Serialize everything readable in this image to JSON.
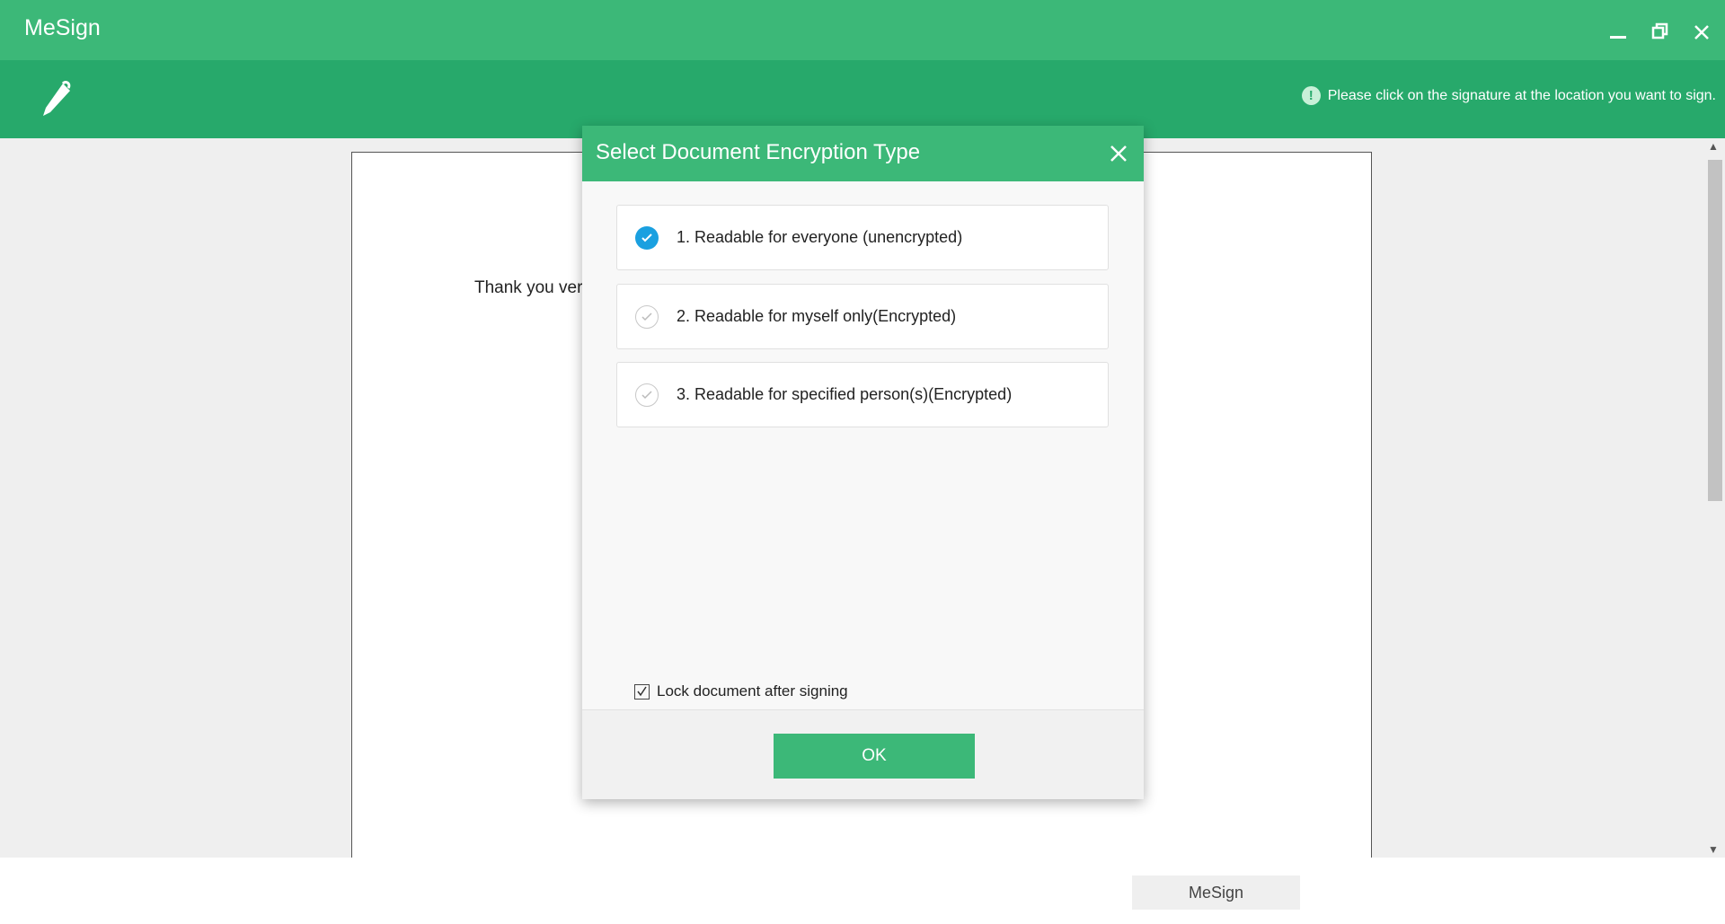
{
  "app": {
    "title": "MeSign"
  },
  "toolbar": {
    "hint": "Please click on the signature at the location you want to sign."
  },
  "document": {
    "text": "Thank you ver"
  },
  "dialog": {
    "title": "Select Document Encryption Type",
    "options": [
      {
        "label": "1. Readable for everyone (unencrypted)",
        "selected": true
      },
      {
        "label": "2. Readable for myself only(Encrypted)",
        "selected": false
      },
      {
        "label": "3. Readable for specified person(s)(Encrypted)",
        "selected": false
      }
    ],
    "lock_label": "Lock document after signing",
    "lock_checked": true,
    "ok_label": "OK"
  },
  "taskbar": {
    "label": "MeSign"
  },
  "colors": {
    "titlebar": "#3cb878",
    "toolbar": "#27a96b",
    "selected": "#1aa0e0"
  }
}
